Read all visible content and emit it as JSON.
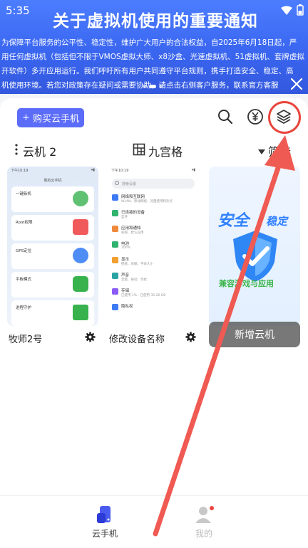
{
  "status_bar": {
    "time": "5:35"
  },
  "banner": {
    "title": "关于虚拟机使用的重要通知",
    "text": "为保障平台服务的公平性、稳定性，维护广大用户的合法权益，自2025年6月18日起，严\n用任何虚拟机（包括但不限于VMOS虚拟大师、x8沙盒、光速虚拟机、51虚拟机、套牌虚拟\n开软件）多开应用运行。我们呼吁所有用户共同遵守平台规则，携手打造安全、稳定、高\n机使用环境。若您对政策存在疑问或需要协助，请点击右侧客户服务，联系官方客服",
    "close_icon": "close-icon"
  },
  "header": {
    "buy_label": "购买云手机",
    "icons": [
      "search-icon",
      "yen-icon",
      "layers-icon"
    ]
  },
  "toolbar": {
    "cloud_label": "云机 2",
    "grid_label": "九宫格",
    "filter_label": "筛选"
  },
  "devices": [
    {
      "name": "牧师2号"
    },
    {
      "name": "修改设备名称"
    }
  ],
  "tile1_screen": {
    "status_time": "下午10:19",
    "header": "我的云手机",
    "rows": [
      "一键新机",
      "Root权限",
      "GPS定位",
      "平板模式",
      "进程守护"
    ]
  },
  "tile2_screen": {
    "status_time": "下午10:19",
    "search_placeholder": "搜索设置",
    "items": [
      {
        "label": "网络和互联网",
        "sub": "WLAN、移动网络、流量使用和热点",
        "color": "#3d7bf5"
      },
      {
        "label": "已连接的设备",
        "sub": "蓝牙",
        "color": "#2fb36e"
      },
      {
        "label": "应用和通知",
        "sub": "权限、默认应用",
        "color": "#f0893b"
      },
      {
        "label": "电池",
        "sub": "100%",
        "color": "#2fb36e"
      },
      {
        "label": "显示",
        "sub": "壁纸、休眠、字体大小",
        "color": "#f0a030"
      },
      {
        "label": "声音",
        "sub": "音量、振动、勿扰",
        "color": "#2aa3a3"
      },
      {
        "label": "存储",
        "sub": "已使用 1% - 已使用 35.26 GB",
        "color": "#8a5cf5"
      },
      {
        "label": "隐私权",
        "sub": "",
        "color": "#3d7bf5"
      }
    ]
  },
  "tile3": {
    "title_a": "安全",
    "title_b": "稳定",
    "subtitle": "兼容游戏与应用",
    "add_label": "新增云机"
  },
  "bottom_nav": {
    "items": [
      {
        "label": "云手机",
        "active": true
      },
      {
        "label": "我的",
        "active": false
      }
    ]
  },
  "colors": {
    "accent": "#5b6cf9",
    "banner": "#3a66f0",
    "annotation": "#e8453c"
  }
}
